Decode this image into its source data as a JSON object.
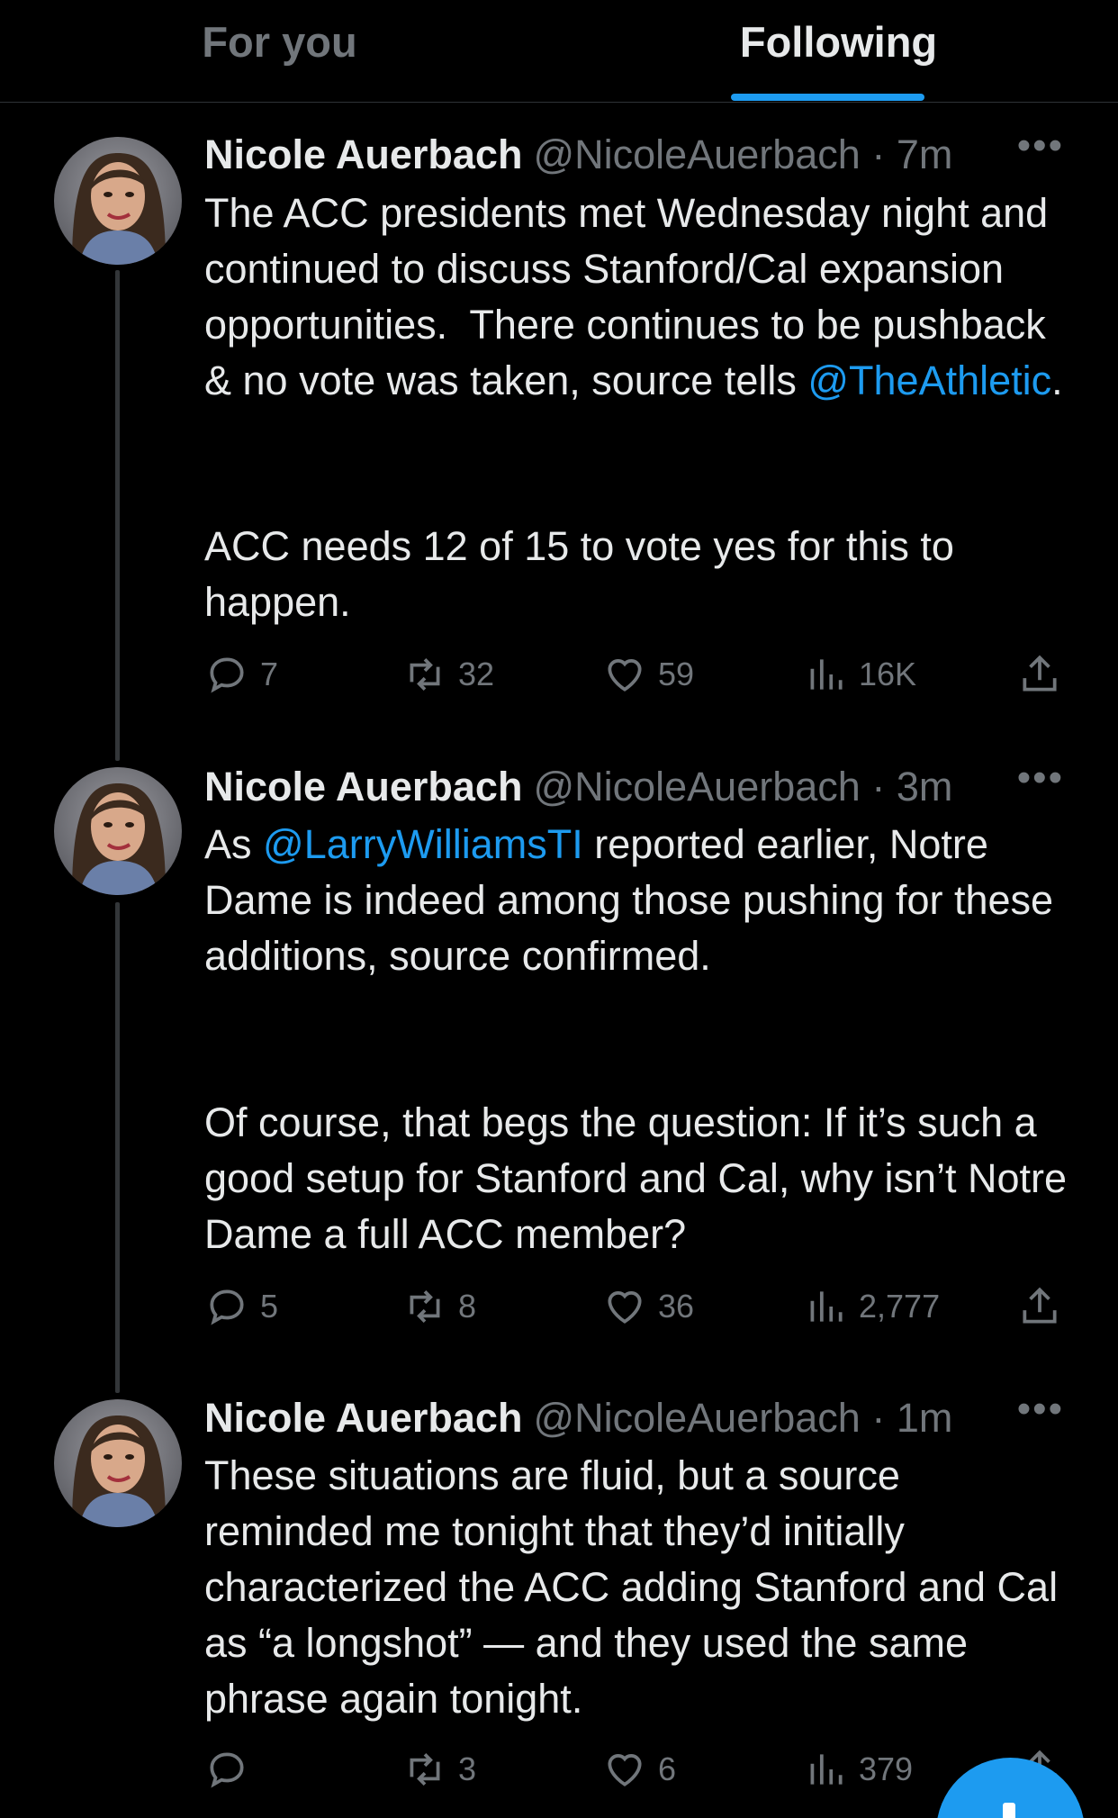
{
  "tabs": [
    {
      "label": "For you",
      "active": false
    },
    {
      "label": "Following",
      "active": true
    }
  ],
  "colors": {
    "accent": "#1d9bf0",
    "muted": "#71767b",
    "text": "#e7e9ea",
    "background": "#000000"
  },
  "tweets": [
    {
      "name": "Nicole Auerbach",
      "handle": "@NicoleAuerbach",
      "time": "· 7m",
      "more": "•••",
      "text_p1_a": "The ACC presidents met Wednesday night and continued to discuss Stanford/Cal expansion opportunities.  There continues to be pushback & no vote was taken, source tells ",
      "mention": "@TheAthletic",
      "text_p1_b": ".",
      "text_p2": "ACC needs 12 of 15 to vote yes for this to happen.",
      "replies": "7",
      "retweets": "32",
      "likes": "59",
      "views": "16K"
    },
    {
      "name": "Nicole Auerbach",
      "handle": "@NicoleAuerbach",
      "time": "· 3m",
      "more": "•••",
      "text_p1_a": "As ",
      "mention": "@LarryWilliamsTI",
      "text_p1_b": " reported earlier, Notre Dame is indeed among those pushing for these additions, source confirmed.",
      "text_p2": "Of course, that begs the question: If it’s such a good setup for Stanford and Cal, why isn’t Notre Dame a full ACC member?",
      "replies": "5",
      "retweets": "8",
      "likes": "36",
      "views": "2,777"
    },
    {
      "name": "Nicole Auerbach",
      "handle": "@NicoleAuerbach",
      "time": "· 1m",
      "more": "•••",
      "text_p1_a": "These situations are fluid, but a source reminded me tonight that they’d initially characterized the ACC adding Stanford and Cal as “a longshot” — and they used the same phrase again tonight.",
      "replies": "",
      "retweets": "3",
      "likes": "6",
      "views": "379"
    }
  ],
  "icons": {
    "reply": "reply-icon",
    "retweet": "retweet-icon",
    "like": "heart-icon",
    "views": "views-icon",
    "share": "share-icon",
    "compose": "compose-plus-icon"
  }
}
